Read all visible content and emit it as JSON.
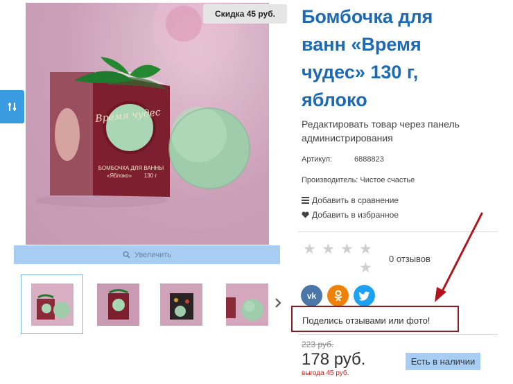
{
  "product": {
    "title": "Бомбочка для ванн «Время чудес» 130 г, яблоко",
    "discount_badge": "Скидка 45 руб.",
    "zoom_label": "Увеличить",
    "admin_link": "Редактировать товар через панель администрирования",
    "sku_label": "Артикул:",
    "sku_value": "6888823",
    "manufacturer": "Производитель: Чистое счастье",
    "compare_label": "Добавить в сравнение",
    "favorite_label": "Добавить в избранное",
    "rating_stars": 0,
    "reviews_count": "0 отзывов",
    "share_prompt": "Поделись отзывами или фото!",
    "old_price": "223 руб.",
    "price": "178 руб.",
    "savings": "выгода 45 руб.",
    "stock_status": "Есть в наличии",
    "box_text": {
      "script_title": "Время чудес",
      "line1": "БОМБОЧКА ДЛЯ ВАННЫ",
      "line2": "«Яблоко»",
      "weight": "130 г"
    }
  },
  "social": [
    {
      "name": "vk",
      "glyph": "vk",
      "color": "#4a76a8"
    },
    {
      "name": "odnoklassniki",
      "glyph": "ok",
      "color": "#ee8208"
    },
    {
      "name": "twitter",
      "glyph": "tw",
      "color": "#1da1f2"
    }
  ],
  "thumbnails": [
    {
      "name": "thumb-pink-box",
      "active": true
    },
    {
      "name": "thumb-red-box",
      "active": false
    },
    {
      "name": "thumb-dark-box",
      "active": false
    },
    {
      "name": "thumb-ball",
      "active": false
    }
  ],
  "colors": {
    "accent": "#1d6ab4",
    "highlight_frame": "#8f1c22",
    "annotation_arrow": "#b3141c",
    "button_bg": "#a8cdf3",
    "sale_red": "#c2281e"
  }
}
